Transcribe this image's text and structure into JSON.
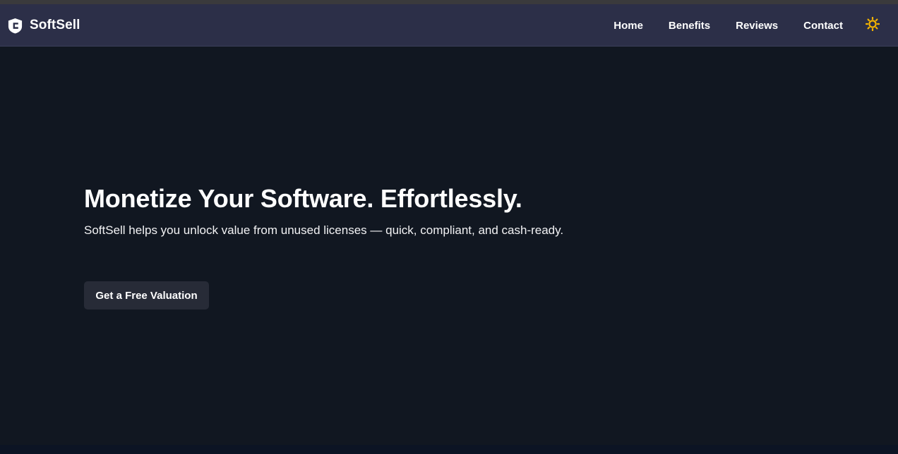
{
  "brand": {
    "name": "SoftSell",
    "icon": "shield-logo-icon"
  },
  "nav": {
    "items": [
      {
        "label": "Home"
      },
      {
        "label": "Benefits"
      },
      {
        "label": "Reviews"
      },
      {
        "label": "Contact"
      }
    ],
    "theme_toggle_icon": "sun-icon"
  },
  "hero": {
    "title": "Monetize Your Software. Effortlessly.",
    "subtitle": "SoftSell helps you unlock value from unused licenses — quick, compliant, and cash-ready.",
    "cta_label": "Get a Free Valuation"
  },
  "colors": {
    "background": "#111721",
    "navbar": "#2c2f48",
    "button": "#272b37",
    "sun": "#f5b400",
    "text": "#ffffff"
  }
}
